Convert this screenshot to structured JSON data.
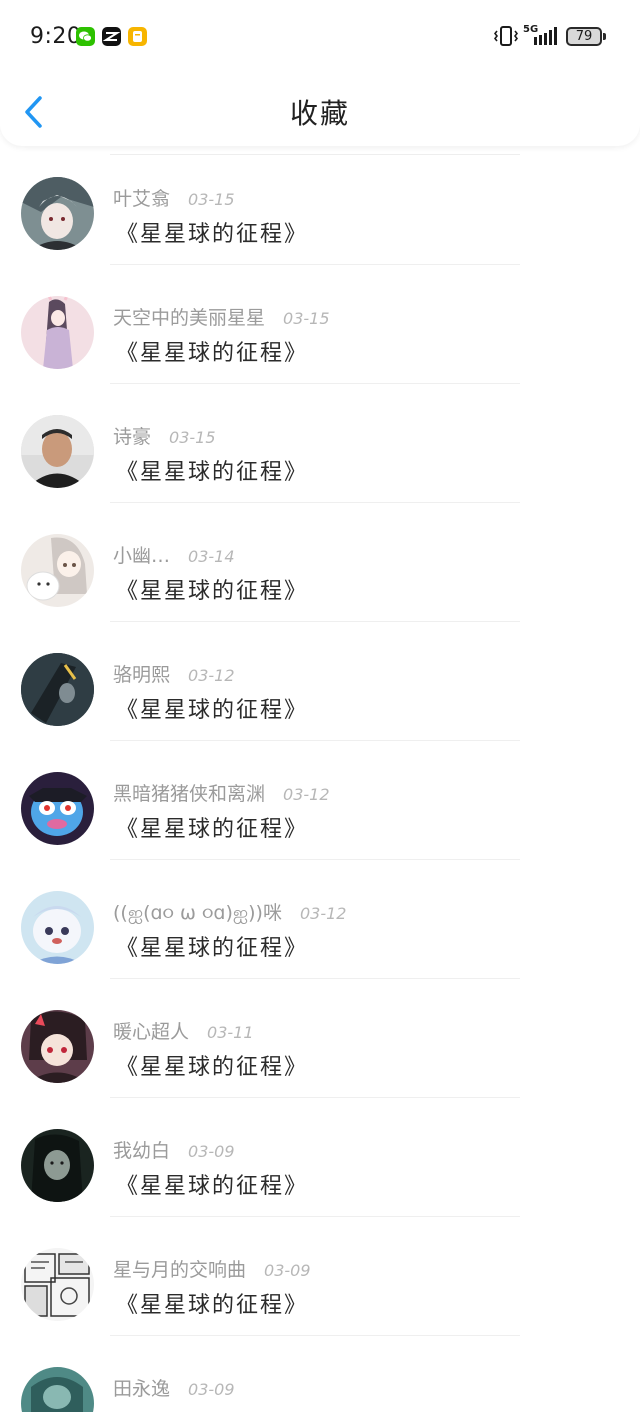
{
  "status_bar": {
    "time": "9:20",
    "network": "5G",
    "battery": "79"
  },
  "header": {
    "title": "收藏"
  },
  "favorites": [
    {
      "user": "叶艾翕",
      "date": "03-15",
      "title": "《星星球的征程》"
    },
    {
      "user": "天空中的美丽星星",
      "date": "03-15",
      "title": "《星星球的征程》"
    },
    {
      "user": "诗豪",
      "date": "03-15",
      "title": "《星星球的征程》"
    },
    {
      "user": "小幽…",
      "date": "03-14",
      "title": "《星星球的征程》"
    },
    {
      "user": "骆明熙",
      "date": "03-12",
      "title": "《星星球的征程》"
    },
    {
      "user": "黑暗猪猪侠和离渊",
      "date": "03-12",
      "title": "《星星球的征程》"
    },
    {
      "user": "((ஐ(ɑ૦ ω ૦ɑ)ஐ))咪",
      "date": "03-12",
      "title": "《星星球的征程》"
    },
    {
      "user": "暖心超人",
      "date": "03-11",
      "title": "《星星球的征程》"
    },
    {
      "user": "我幼白",
      "date": "03-09",
      "title": "《星星球的征程》"
    },
    {
      "user": "星与月的交响曲",
      "date": "03-09",
      "title": "《星星球的征程》"
    },
    {
      "user": "田永逸",
      "date": "03-09",
      "title": ""
    }
  ],
  "colors": {
    "accent": "#2196f3",
    "title_text": "#2b2b2b",
    "meta_text": "#9b9b9b",
    "date_text": "#b7b7b7",
    "divider": "#efefef"
  },
  "icons": {
    "back": "chevron-left-icon",
    "vibrate": "vibrate-icon",
    "signal": "signal-bars-icon",
    "battery": "battery-icon"
  }
}
